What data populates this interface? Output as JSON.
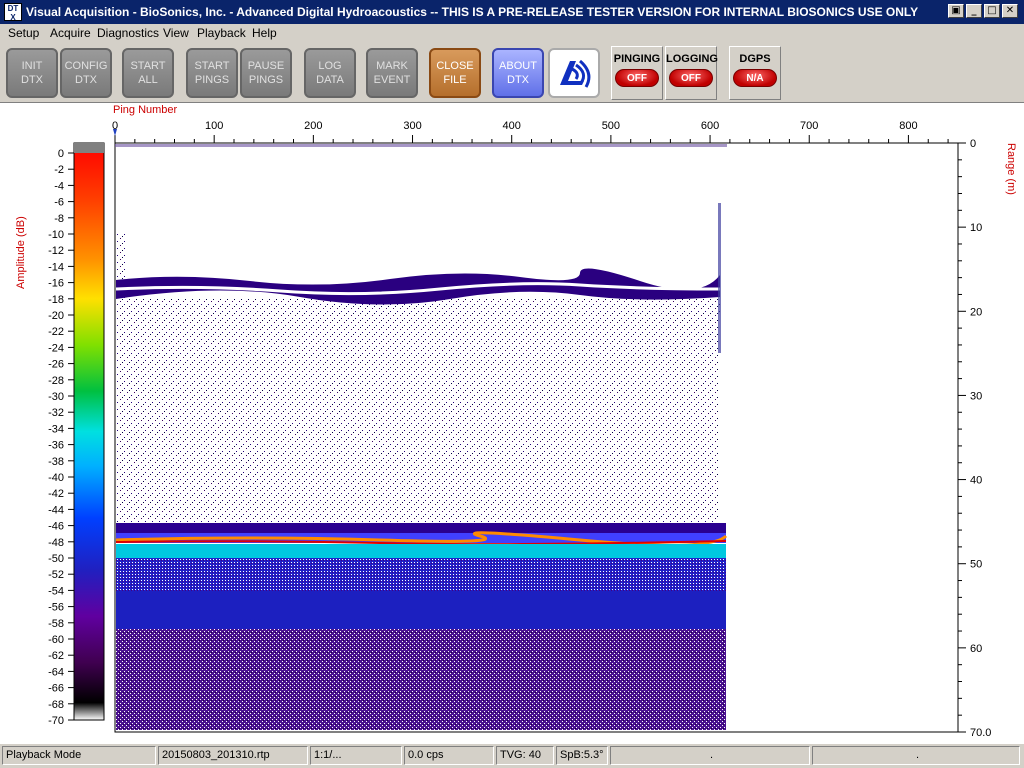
{
  "window": {
    "icon_text": "DT\nX",
    "title": "Visual Acquisition  -  BioSonics, Inc.  -  Advanced Digital Hydroacoustics  -- THIS IS A PRE-RELEASE TESTER VERSION FOR INTERNAL BIOSONICS USE ONLY",
    "restore_icon": "restore-icon",
    "minimize_icon": "minimize-icon",
    "maximize_icon": "maximize-icon",
    "close_icon": "close-icon"
  },
  "menu": [
    "Setup",
    "Acquire",
    "Diagnostics",
    "View",
    "Playback",
    "Help"
  ],
  "toolbar": {
    "buttons": [
      {
        "line1": "INIT",
        "line2": "DTX"
      },
      {
        "line1": "CONFIG",
        "line2": "DTX"
      },
      {
        "line1": "START",
        "line2": "ALL"
      },
      {
        "line1": "START",
        "line2": "PINGS"
      },
      {
        "line1": "PAUSE",
        "line2": "PINGS"
      },
      {
        "line1": "LOG",
        "line2": "DATA"
      },
      {
        "line1": "MARK",
        "line2": "EVENT"
      },
      {
        "line1": "CLOSE",
        "line2": "FILE"
      },
      {
        "line1": "ABOUT",
        "line2": "DTX"
      }
    ],
    "logo_icon": "biosonics-logo-icon",
    "indicators": [
      {
        "label": "PINGING",
        "state": "OFF"
      },
      {
        "label": "LOGGING",
        "state": "OFF"
      },
      {
        "label": "DGPS",
        "state": "N/A"
      }
    ]
  },
  "echogram": {
    "x_axis_title": "Ping Number",
    "x_ticks": [
      "0",
      "100",
      "200",
      "300",
      "400",
      "500",
      "600",
      "700",
      "800"
    ],
    "right_axis_title": "Range (m)",
    "right_ticks": [
      "0",
      "10",
      "20",
      "30",
      "40",
      "50",
      "60",
      "70.0"
    ],
    "left_axis_title": "Amplitude (dB)",
    "amp_ticks": [
      "0",
      "-2",
      "-4",
      "-6",
      "-8",
      "-10",
      "-12",
      "-14",
      "-16",
      "-18",
      "-20",
      "-22",
      "-24",
      "-26",
      "-28",
      "-30",
      "-32",
      "-34",
      "-36",
      "-38",
      "-40",
      "-42",
      "-44",
      "-46",
      "-48",
      "-50",
      "-52",
      "-54",
      "-56",
      "-58",
      "-60",
      "-62",
      "-64",
      "-66",
      "-68",
      "-70"
    ],
    "colors": {
      "accent_label": "#cc0000",
      "water_fill": "#ffffff"
    }
  },
  "chart_data": {
    "type": "heatmap",
    "xlabel": "Ping Number",
    "ylabel": "Range (m)",
    "colorbar_label": "Amplitude (dB)",
    "xlim": [
      0,
      850
    ],
    "ylim": [
      0,
      70
    ],
    "colorbar_range": [
      -70,
      0
    ],
    "pings_recorded": 610,
    "surface_layer_depth_m": 17,
    "bottom_depth_m": 47
  },
  "statusbar": [
    "Playback Mode",
    "20150803_201310.rtp",
    "1:1/...",
    "0.0 cps",
    "TVG: 40",
    "SpB:5.3°",
    ".",
    "."
  ]
}
